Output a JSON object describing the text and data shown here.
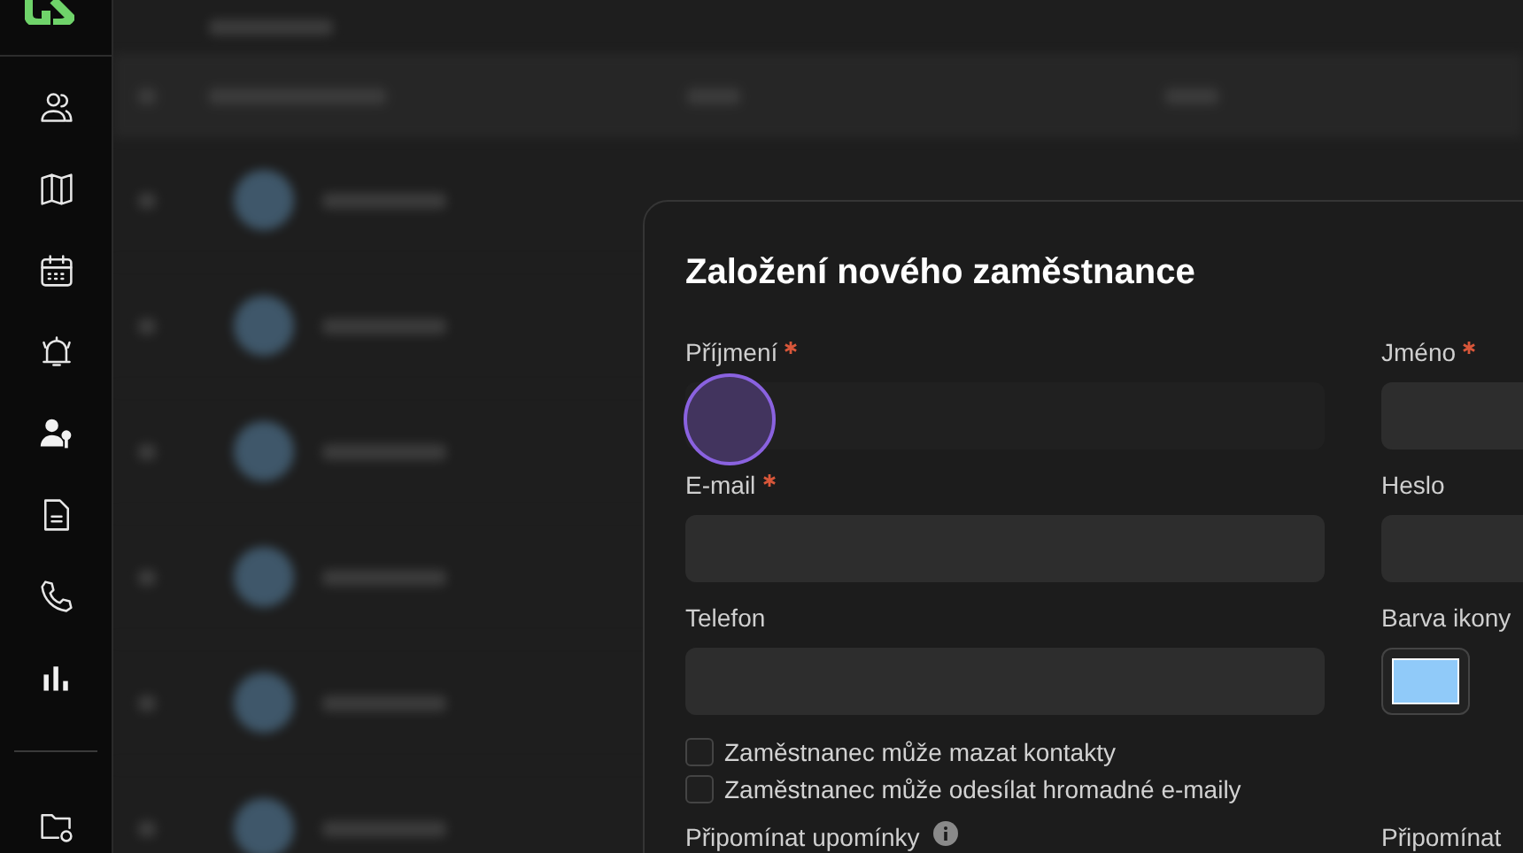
{
  "dialog": {
    "title": "Založení nového zaměstnance",
    "fields": [
      {
        "label": "Příjmení",
        "required": true,
        "focused": true,
        "kind": "text"
      },
      {
        "label": "Jméno",
        "required": true,
        "focused": false,
        "kind": "text"
      },
      {
        "label": "E-mail",
        "required": true,
        "focused": false,
        "kind": "text"
      },
      {
        "label": "Heslo",
        "required": false,
        "focused": false,
        "kind": "text"
      },
      {
        "label": "Telefon",
        "required": false,
        "focused": false,
        "kind": "text"
      },
      {
        "label": "Barva ikony",
        "required": false,
        "kind": "color",
        "color": "#90caf9"
      }
    ],
    "checkboxes": [
      {
        "label": "Zaměstnanec může mazat kontakty",
        "checked": false
      },
      {
        "label": "Zaměstnanec může odesílat hromadné e-maily",
        "checked": false
      }
    ],
    "bottom_labels": [
      {
        "label": "Připomínat upomínky",
        "info": true
      },
      {
        "label": "Připomínat",
        "info": false
      }
    ]
  }
}
